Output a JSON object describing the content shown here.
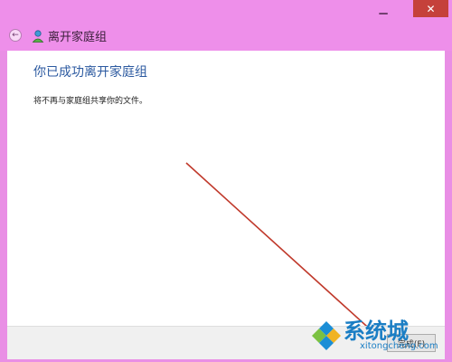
{
  "window": {
    "minimize_glyph": "▁",
    "close_glyph": "✕"
  },
  "nav": {
    "back_glyph": "←",
    "title": "离开家庭组",
    "icon": "homegroup-icon"
  },
  "main": {
    "heading": "你已成功离开家庭组",
    "description": "将不再与家庭组共享你的文件。"
  },
  "footer": {
    "finish_label": "完成(F)"
  },
  "watermark": {
    "brand": "系统城",
    "site": "xitongcheng.com"
  },
  "colors": {
    "frame": "#ee8fea",
    "heading": "#2c5aa0",
    "close": "#c5413b",
    "arrow": "#c0392b",
    "watermark": "#1b7ec4"
  }
}
